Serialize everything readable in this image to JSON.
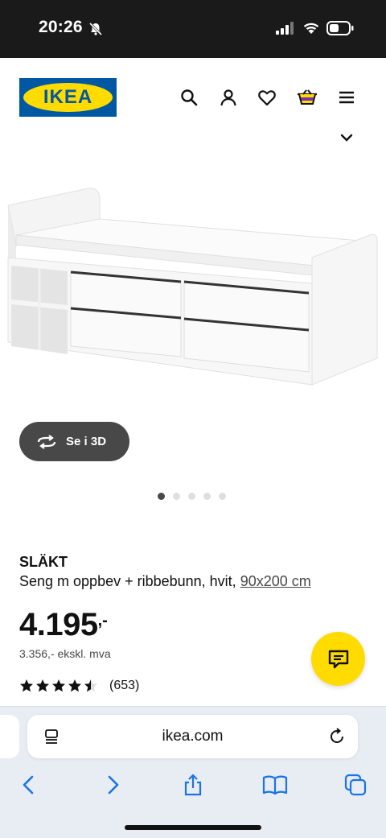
{
  "status_bar": {
    "time": "20:26",
    "icons": [
      "bell-slash-icon",
      "signal-icon",
      "wifi-icon",
      "battery-icon"
    ]
  },
  "header": {
    "logo_text": "IKEA",
    "brand_blue": "#0058a3",
    "brand_yellow": "#ffdb00",
    "icons": [
      "search-icon",
      "user-icon",
      "heart-icon",
      "cart-icon",
      "menu-icon"
    ]
  },
  "gallery": {
    "view_3d_label": "Se i 3D",
    "image_count": 5,
    "active_index": 0
  },
  "product": {
    "name": "SLÄKT",
    "description": "Seng m oppbev + ribbebunn, hvit, ",
    "size": "90x200 cm",
    "price": "4.195",
    "price_suffix": ",-",
    "price_ex_vat": "3.356,- ekskl. mva",
    "rating_value": 4.5,
    "rating_max": 5,
    "rating_count": "(653)"
  },
  "browser": {
    "url": "ikea.com",
    "toolbar": [
      "back-icon",
      "forward-icon",
      "share-icon",
      "bookmarks-icon",
      "tabs-icon"
    ]
  }
}
